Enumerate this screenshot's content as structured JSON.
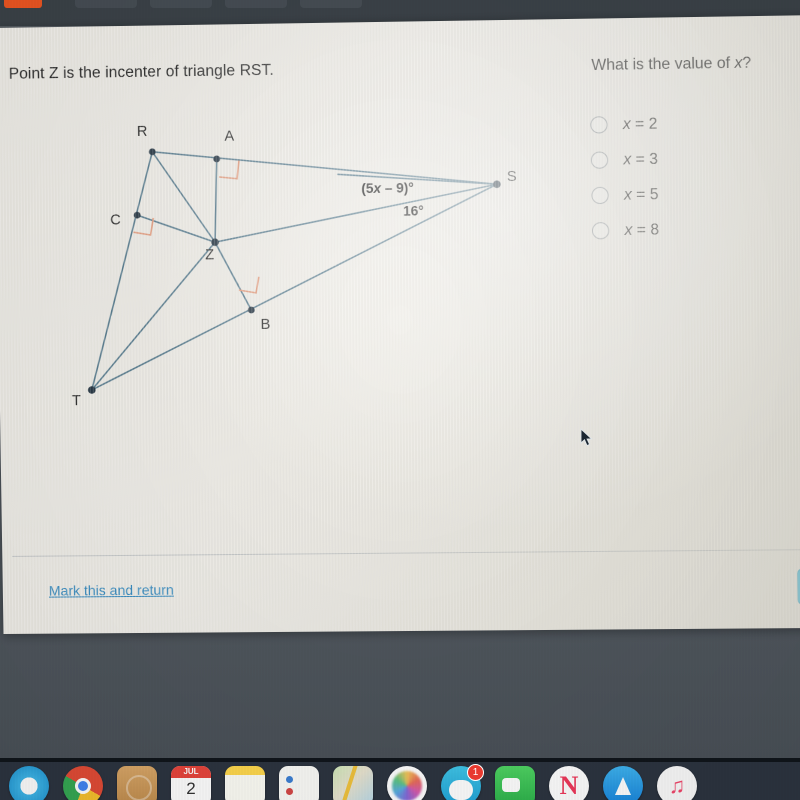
{
  "browser": {
    "tab_count": 4
  },
  "question": {
    "prompt": "Point Z is the incenter of triangle RST.",
    "question_text_pre": "What is the value of ",
    "question_variable": "x",
    "question_text_post": "?"
  },
  "choices": [
    {
      "id": "choice-a",
      "variable": "x",
      "equals": " = 2",
      "label": "x = 2",
      "selected": false
    },
    {
      "id": "choice-b",
      "variable": "x",
      "equals": " = 3",
      "label": "x = 3",
      "selected": false
    },
    {
      "id": "choice-c",
      "variable": "x",
      "equals": " = 5",
      "label": "x = 5",
      "selected": false
    },
    {
      "id": "choice-d",
      "variable": "x",
      "equals": " = 8",
      "label": "x = 8",
      "selected": false
    }
  ],
  "figure": {
    "vertex_labels": {
      "R": "R",
      "A": "A",
      "S": "S",
      "C": "C",
      "Z": "Z",
      "B": "B",
      "T": "T"
    },
    "angle_labels": {
      "upper": "(5x – 9)°",
      "upper_prefix": "(5",
      "upper_var": "x",
      "upper_suffix": " – 9)°",
      "lower": "16°"
    },
    "stroke_color": "#5b7f92",
    "right_angle_color": "#e8a183",
    "point_color": "#2b3b48"
  },
  "footer": {
    "mark_and_return": "Mark this and return",
    "next_button_color": "#42c2e8"
  },
  "dock": {
    "items": [
      {
        "name": "safari",
        "label": "Safari",
        "badge": null
      },
      {
        "name": "chrome",
        "label": "Chrome",
        "badge": null
      },
      {
        "name": "finder",
        "label": "Finder",
        "badge": null
      },
      {
        "name": "calendar",
        "label": "Calendar",
        "badge": null,
        "month": "JUL",
        "day": "2"
      },
      {
        "name": "notes",
        "label": "Notes",
        "badge": null
      },
      {
        "name": "contacts",
        "label": "Contacts",
        "badge": null
      },
      {
        "name": "maps",
        "label": "Maps",
        "badge": null
      },
      {
        "name": "photos",
        "label": "Photos",
        "badge": null
      },
      {
        "name": "messages",
        "label": "Messages",
        "badge": "1"
      },
      {
        "name": "facetime",
        "label": "FaceTime",
        "badge": null
      },
      {
        "name": "news",
        "label": "News",
        "badge": null
      },
      {
        "name": "appstore",
        "label": "App Store",
        "badge": null
      },
      {
        "name": "music",
        "label": "Music",
        "badge": null
      }
    ]
  }
}
